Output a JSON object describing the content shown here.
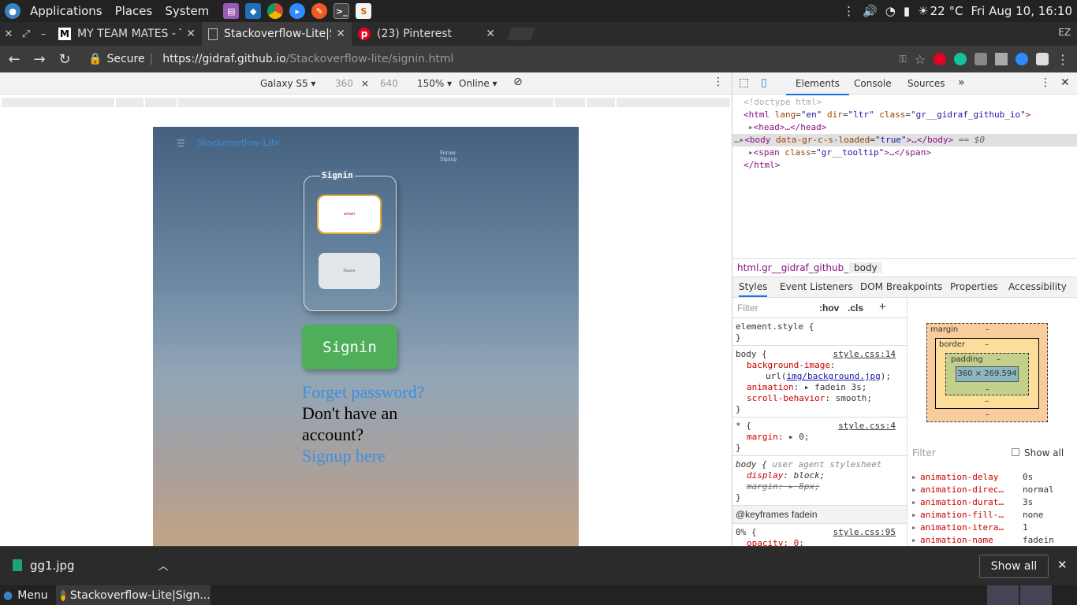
{
  "panel": {
    "applications": "Applications",
    "places": "Places",
    "system": "System",
    "temperature": "22 °C",
    "datetime": "Fri Aug 10, 16:10"
  },
  "tabs": [
    {
      "title": "MY TEAM MATES - T",
      "favicon": "M"
    },
    {
      "title": "Stackoverflow-Lite|S",
      "favicon": "doc-icon"
    },
    {
      "title": "(23) Pinterest",
      "favicon": "pinterest-icon"
    }
  ],
  "profile": "EZ",
  "omnibox": {
    "secure": "Secure",
    "url_host": "https://gidraf.github.io",
    "url_path": "/Stackoverflow-lite/signin.html"
  },
  "device_bar": {
    "device": "Galaxy S5 ▾",
    "width": "360",
    "times": "×",
    "height": "640",
    "zoom": "150% ▾",
    "network": "Online ▾"
  },
  "page": {
    "menu_glyph": "☰",
    "brand": "Stackoverflow-Lite",
    "nav": [
      "Forum",
      "Signup"
    ],
    "legend": "Signin",
    "email_placeholder": "email",
    "password_placeholder": "Passw",
    "signin_button": "Signin",
    "forgot": "Forget password?",
    "no_account": "Don't have an account?",
    "signup": "Signup here"
  },
  "devtools": {
    "tabs": [
      "Elements",
      "Console",
      "Sources",
      "»"
    ],
    "dom": {
      "doctype": "<!doctype html>",
      "html_open_tag": "html",
      "html_attrs": [
        {
          "name": "lang",
          "value": "\"en\""
        },
        {
          "name": "dir",
          "value": "\"ltr\""
        },
        {
          "name": "class",
          "value": "\"gr__gidraf_github_io\""
        }
      ],
      "head": "<head>…</head>",
      "body_tag": "body",
      "body_attr_name": "data-gr-c-s-loaded",
      "body_attr_value": "\"true\"",
      "body_close": ">…</body>",
      "body_marker": "== $0",
      "span_tag": "span",
      "span_attr_name": "class",
      "span_attr_value": "\"gr__tooltip\"",
      "span_close": ">…</span>",
      "html_close": "</html>"
    },
    "crumbs": [
      "html.gr__gidraf_github_io",
      "body"
    ],
    "subtabs": [
      "Styles",
      "Event Listeners",
      "DOM Breakpoints",
      "Properties",
      "Accessibility"
    ],
    "filter_placeholder": "Filter",
    "hov": ":hov",
    "cls": ".cls",
    "plus": "+",
    "rules": {
      "element_style": "element.style {",
      "close": "}",
      "body_selector": "body {",
      "body_src": "style.css:14",
      "bg_image_prop": "background-image",
      "bg_image_val_pre": "url(",
      "bg_image_link": "img/background.jpg",
      "bg_image_val_post": ");",
      "animation_prop": "animation",
      "animation_val": "▸ fadein 3s;",
      "scroll_prop": "scroll-behavior",
      "scroll_val": "smooth;",
      "star_selector": "* {",
      "star_src": "style.css:4",
      "margin_prop": "margin",
      "margin_val": "▸ 0;",
      "ua_selector": "body {",
      "ua_label": "user agent stylesheet",
      "display_prop": "display",
      "display_val": "block;",
      "ua_margin_prop": "margin",
      "ua_margin_val": "▸ 8px;",
      "keyframes": "@keyframes fadein",
      "kf_selector": "0% {",
      "kf_src": "style.css:95",
      "opacity_partial": "opacity: 0;"
    },
    "boxmodel": {
      "margin": "margin",
      "border": "border",
      "padding": "padding",
      "dash": "–",
      "content": "360 × 269.594"
    },
    "computed_filter": "Filter",
    "show_all": "Show all",
    "computed": [
      {
        "prop": "animation-delay",
        "val": "0s"
      },
      {
        "prop": "animation-direc…",
        "val": "normal"
      },
      {
        "prop": "animation-durat…",
        "val": "3s"
      },
      {
        "prop": "animation-fill-…",
        "val": "none"
      },
      {
        "prop": "animation-itera…",
        "val": "1"
      },
      {
        "prop": "animation-name",
        "val": "fadein"
      }
    ]
  },
  "downloads": {
    "file": "gg1.jpg",
    "show_all": "Show all"
  },
  "taskbar": {
    "menu": "Menu",
    "window": "Stackoverflow-Lite|Sign..."
  }
}
